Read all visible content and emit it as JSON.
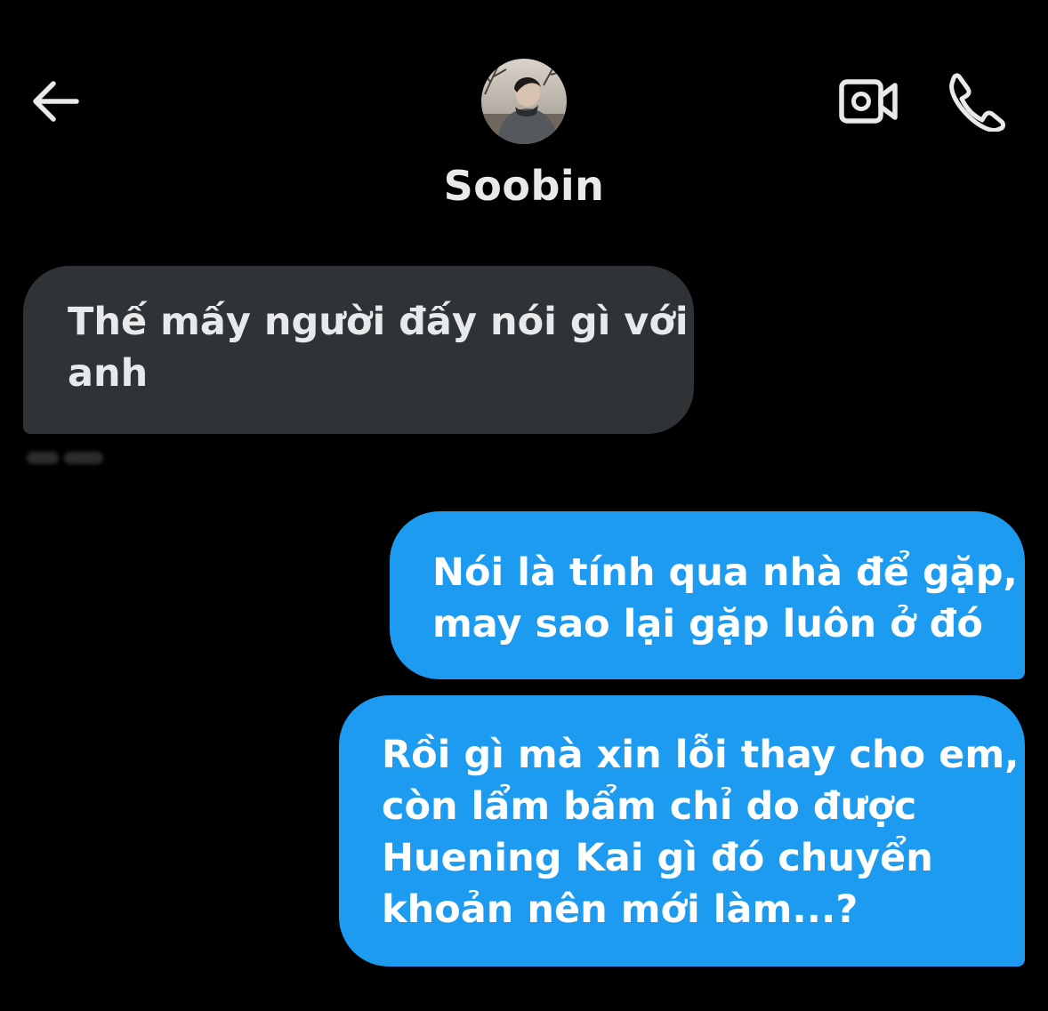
{
  "header": {
    "back_icon": "arrow-left-icon",
    "contact_name": "Soobin",
    "video_icon": "video-camera-icon",
    "phone_icon": "phone-icon"
  },
  "messages": [
    {
      "direction": "received",
      "lines": [
        "Thế mấy người đấy nói gì với",
        "anh"
      ]
    },
    {
      "direction": "sent",
      "lines": [
        "Nói là tính qua nhà để gặp,",
        "may sao lại gặp luôn ở đó"
      ]
    },
    {
      "direction": "sent",
      "lines": [
        "Rồi gì mà xin lỗi thay cho em,",
        "còn lẩm bẩm chỉ do được",
        "Huening Kai gì đó chuyển",
        "khoản nên mới làm...?"
      ]
    }
  ],
  "colors": {
    "background": "#000000",
    "received_bubble": "#2f3336",
    "sent_bubble": "#1d9bf0",
    "text_primary": "#e7e9ea",
    "text_on_sent": "#ffffff"
  }
}
